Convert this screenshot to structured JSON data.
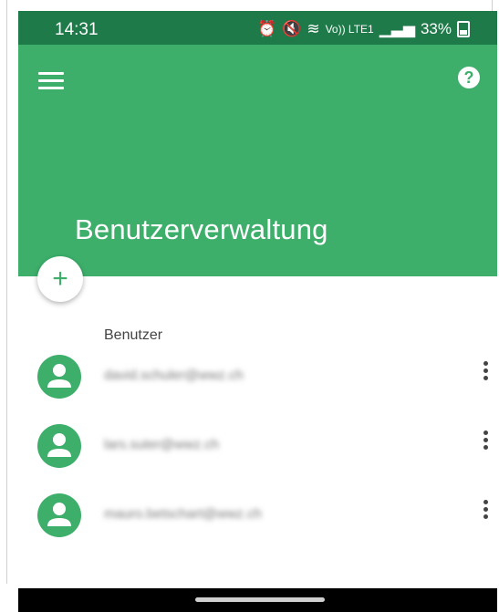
{
  "status_bar": {
    "time": "14:31",
    "icons": [
      "alarm-icon",
      "mute-icon",
      "wifi-icon",
      "volte-icon",
      "signal-icon"
    ],
    "volte_label": "Vo)) LTE1",
    "battery": "33%"
  },
  "app_bar": {
    "title": "Benutzerverwaltung",
    "menu_icon": "hamburger-menu-icon",
    "help_icon": "help-icon",
    "help_glyph": "?",
    "fab_glyph": "+"
  },
  "users": {
    "section_label": "Benutzer",
    "items": [
      {
        "email": "david.schuler@wwz.ch"
      },
      {
        "email": "lars.suter@wwz.ch"
      },
      {
        "email": "mauro.betschart@wwz.ch"
      }
    ]
  },
  "colors": {
    "status_bar": "#1f7a4a",
    "app_bar": "#3daf6b",
    "accent": "#3daf6b"
  }
}
